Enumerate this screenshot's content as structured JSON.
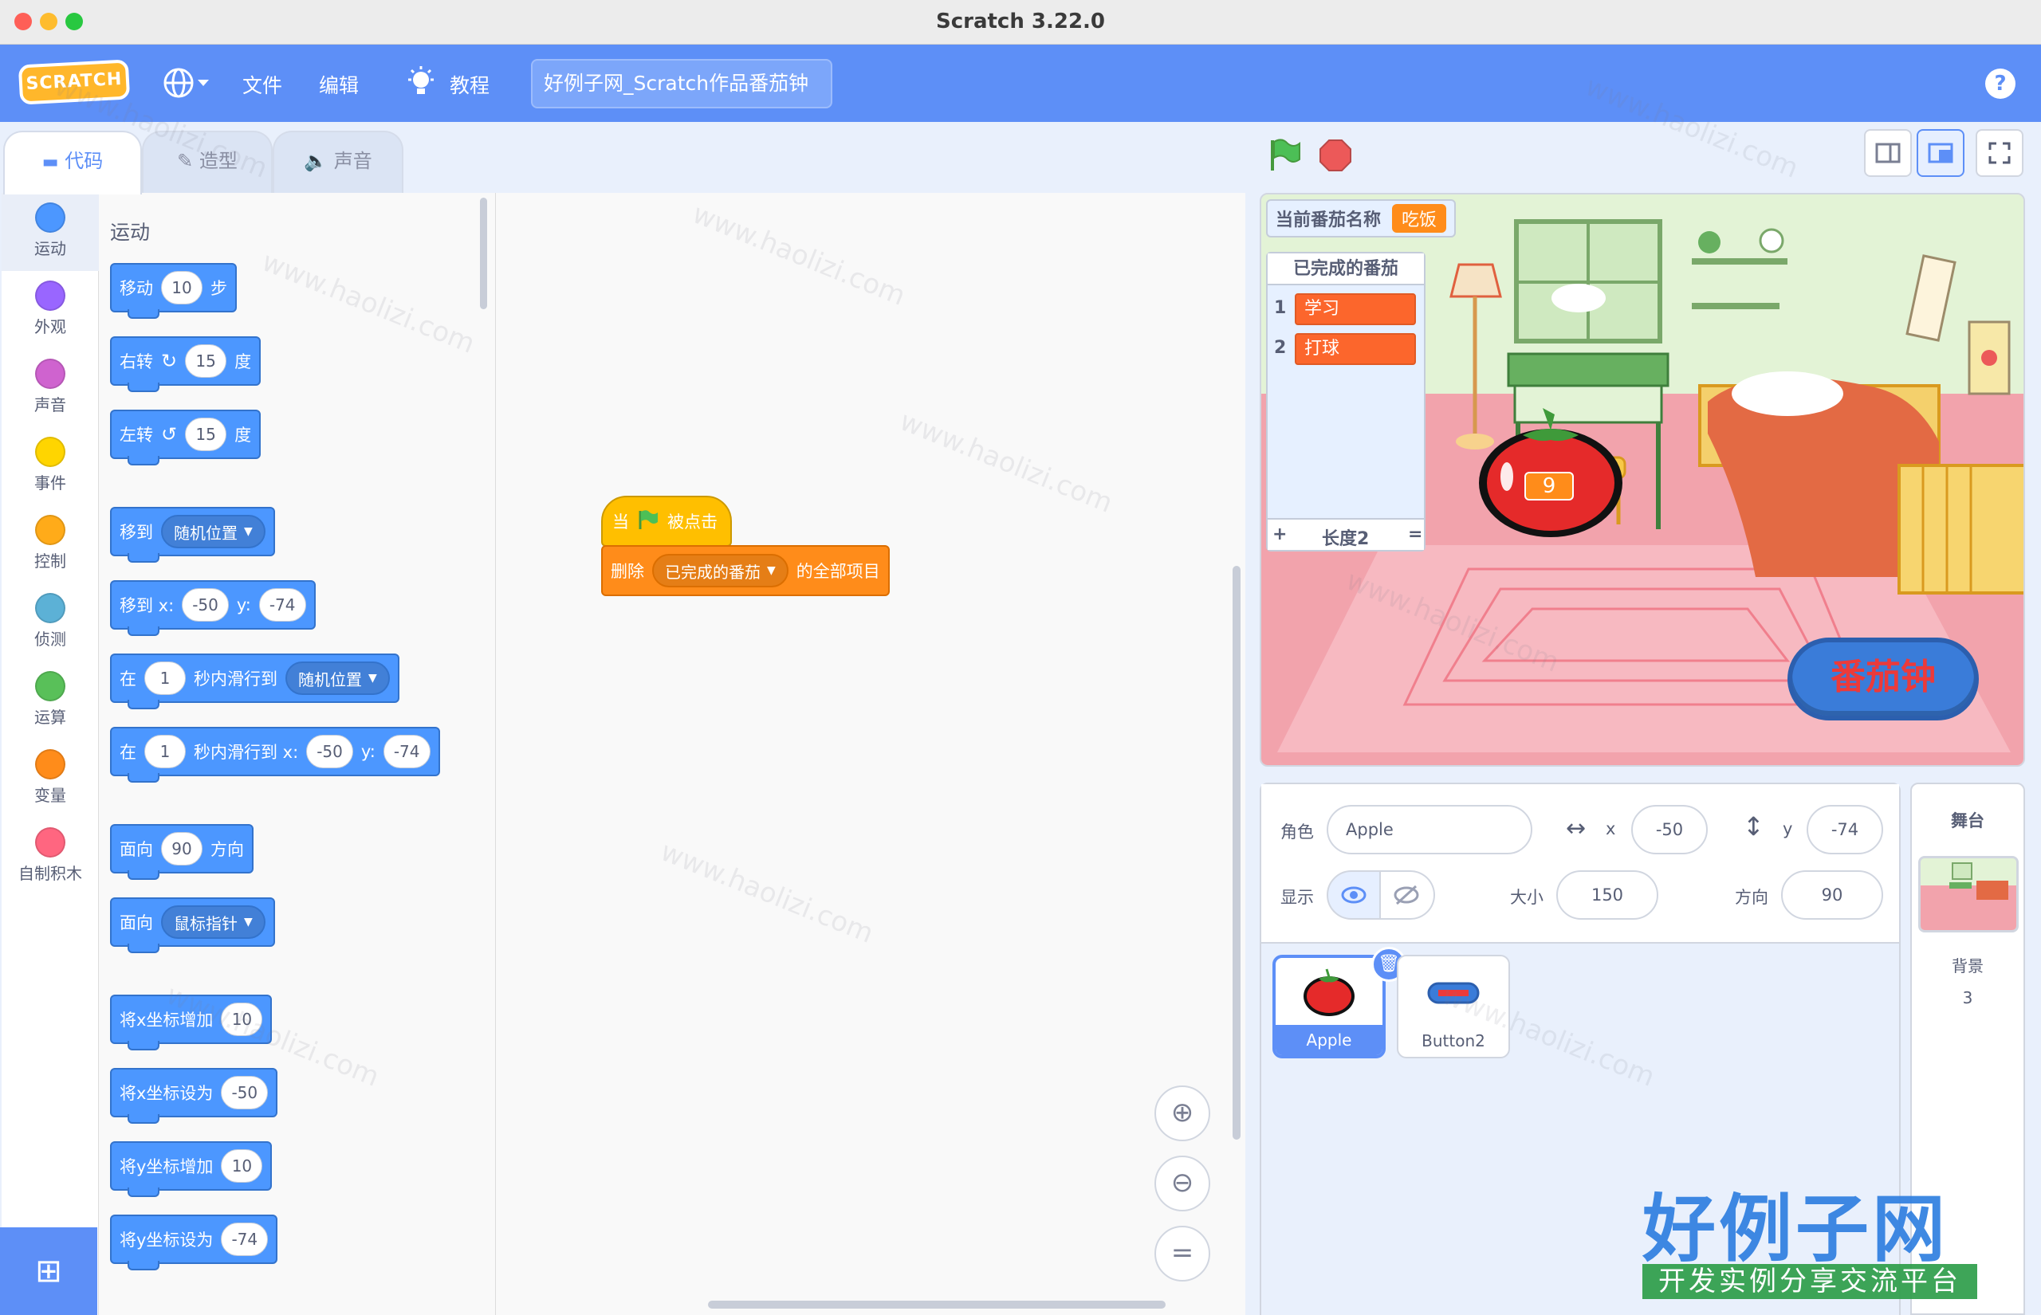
{
  "window": {
    "title": "Scratch 3.22.0"
  },
  "menubar": {
    "logo": "SCRATCH",
    "file": "文件",
    "edit": "编辑",
    "tutorials": "教程",
    "project_title": "好例子网_Scratch作品番茄钟",
    "help": "?"
  },
  "tabs": {
    "code": "代码",
    "costumes": "造型",
    "sounds": "声音"
  },
  "categories": [
    {
      "label": "运动",
      "color": "#4c97ff"
    },
    {
      "label": "外观",
      "color": "#9966ff"
    },
    {
      "label": "声音",
      "color": "#cf63cf"
    },
    {
      "label": "事件",
      "color": "#ffd500"
    },
    {
      "label": "控制",
      "color": "#ffab19"
    },
    {
      "label": "侦测",
      "color": "#5cb1d6"
    },
    {
      "label": "运算",
      "color": "#59c059"
    },
    {
      "label": "变量",
      "color": "#ff8c1a"
    },
    {
      "label": "自制积木",
      "color": "#ff6680"
    }
  ],
  "palette": {
    "section": "运动",
    "move": {
      "a": "移动",
      "v": "10",
      "b": "步"
    },
    "turn_right": {
      "a": "右转",
      "v": "15",
      "b": "度"
    },
    "turn_left": {
      "a": "左转",
      "v": "15",
      "b": "度"
    },
    "goto": {
      "a": "移到",
      "dd": "随机位置"
    },
    "goto_xy": {
      "a": "移到 x:",
      "x": "-50",
      "b": "y:",
      "y": "-74"
    },
    "glide": {
      "a": "在",
      "v": "1",
      "b": "秒内滑行到",
      "dd": "随机位置"
    },
    "glide_xy": {
      "a": "在",
      "v": "1",
      "b": "秒内滑行到 x:",
      "x": "-50",
      "c": "y:",
      "y": "-74"
    },
    "point_dir": {
      "a": "面向",
      "v": "90",
      "b": "方向"
    },
    "point_towards": {
      "a": "面向",
      "dd": "鼠标指针"
    },
    "change_x": {
      "a": "将x坐标增加",
      "v": "10"
    },
    "set_x": {
      "a": "将x坐标设为",
      "v": "-50"
    },
    "change_y": {
      "a": "将y坐标增加",
      "v": "10"
    },
    "set_y": {
      "a": "将y坐标设为",
      "v": "-74"
    }
  },
  "script": {
    "hat": {
      "a": "当",
      "b": "被点击"
    },
    "delete_all": {
      "a": "删除",
      "dd": "已完成的番茄",
      "b": "的全部项目"
    }
  },
  "stage": {
    "var_monitor": {
      "label": "当前番茄名称",
      "value": "吃饭"
    },
    "list_monitor": {
      "title": "已完成的番茄",
      "items": [
        "学习",
        "打球"
      ],
      "footer_add": "+",
      "length": "长度2",
      "footer_eq": "="
    },
    "tomato_value": "9",
    "button_text": "番茄钟"
  },
  "sprite_info": {
    "sprite_label": "角色",
    "sprite_name": "Apple",
    "x_label": "x",
    "x": "-50",
    "y_label": "y",
    "y": "-74",
    "show_label": "显示",
    "size_label": "大小",
    "size": "150",
    "direction_label": "方向",
    "direction": "90"
  },
  "sprites": [
    {
      "name": "Apple"
    },
    {
      "name": "Button2"
    }
  ],
  "stage_pane": {
    "title": "舞台",
    "backdrops_label": "背景",
    "backdrop_count": "3"
  },
  "watermark": {
    "brand": "好例子网",
    "slogan": "开发实例分享交流平台",
    "tile": "www.haolizi.com"
  }
}
